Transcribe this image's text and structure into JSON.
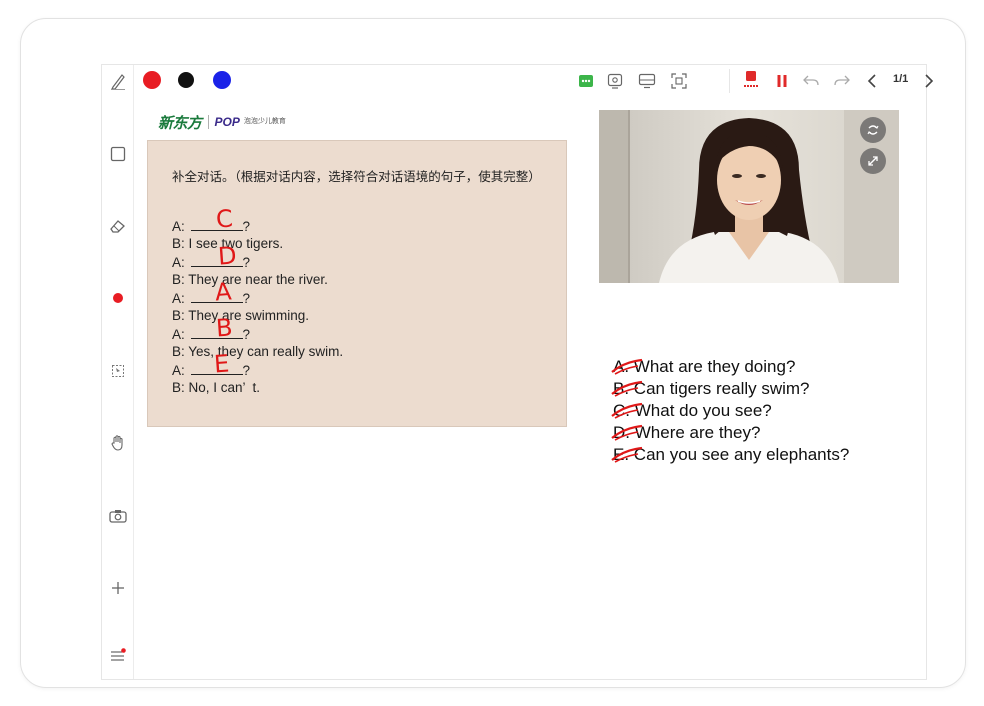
{
  "toolbar": {
    "pen_colors": [
      {
        "name": "red",
        "hex": "#e81c23"
      },
      {
        "name": "black",
        "hex": "#111111"
      },
      {
        "name": "blue",
        "hex": "#1a22e8"
      }
    ],
    "page_indicator": "1/1",
    "icons": [
      "chat-icon",
      "stamp-icon",
      "screen-icon",
      "capture-icon",
      "record-icon",
      "pause-icon",
      "undo-icon",
      "redo-icon",
      "prev-page-icon",
      "next-page-icon"
    ],
    "accent_green": "#3cb54a",
    "accent_red": "#e02a2a"
  },
  "sidebar": {
    "icons": [
      "pen-icon",
      "square-icon",
      "eraser-icon",
      "record-dot-icon",
      "crop-icon",
      "hand-icon",
      "camera-icon",
      "plus-icon",
      "menu-icon"
    ]
  },
  "logos": {
    "xdf": "新东方",
    "pop": "POP",
    "pop_cn": "泡泡少儿教育"
  },
  "exercise": {
    "instruction": "补全对话。（根据对话内容，选择符合对话语境的句子，使其完整）",
    "lines": [
      {
        "speaker": "A:",
        "text": "",
        "blank": true,
        "suffix": "?",
        "answer": "C"
      },
      {
        "speaker": "B:",
        "text": "I see two tigers."
      },
      {
        "speaker": "A:",
        "text": "",
        "blank": true,
        "suffix": "?",
        "answer": "D"
      },
      {
        "speaker": "B:",
        "text": "They are near the river."
      },
      {
        "speaker": "A:",
        "text": "",
        "blank": true,
        "suffix": "?",
        "answer": "A"
      },
      {
        "speaker": "B:",
        "text": "They are swimming."
      },
      {
        "speaker": "A:",
        "text": "",
        "blank": true,
        "suffix": "?",
        "answer": "B"
      },
      {
        "speaker": "B:",
        "text": "Yes, they can really swim."
      },
      {
        "speaker": "A:",
        "text": "",
        "blank": true,
        "suffix": "?",
        "answer": "E"
      },
      {
        "speaker": "B:",
        "text": "No, I can’  t."
      }
    ]
  },
  "options": [
    {
      "letter": "A.",
      "text": "What are they doing?"
    },
    {
      "letter": "B.",
      "text": "Can tigers really swim?"
    },
    {
      "letter": "C.",
      "text": "What do you see?"
    },
    {
      "letter": "D.",
      "text": "Where are they?"
    },
    {
      "letter": "E.",
      "text": "Can you see any elephants?"
    }
  ],
  "video": {
    "controls": [
      "switch-camera-icon",
      "expand-icon"
    ]
  },
  "annotation_color": "#e01818"
}
